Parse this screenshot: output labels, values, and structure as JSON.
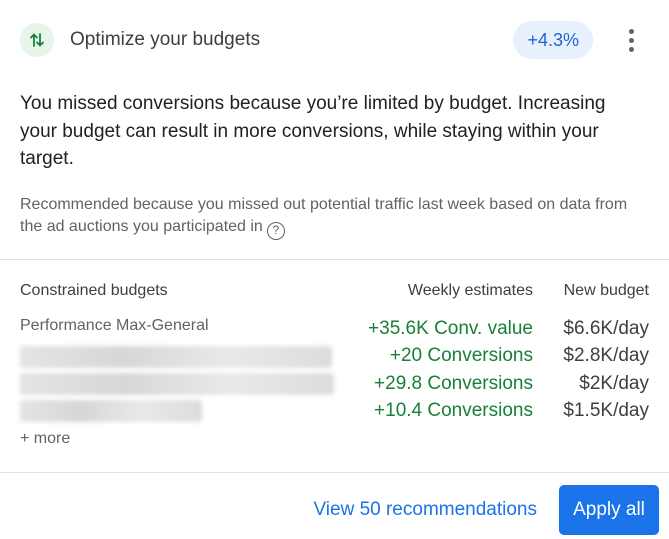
{
  "header": {
    "title": "Optimize your budgets",
    "uplift_badge": "+4.3%",
    "icon": "up-down-arrows-icon",
    "menu_icon": "more-vert-icon"
  },
  "headline": "You missed conversions because you’re limited by budget. Increasing your budget can result in more conversions, while staying within your target.",
  "reason": {
    "text": "Recommended because you missed out potential traffic last week based on data from the ad auctions you participated in",
    "help_icon": "help-circle-icon"
  },
  "table": {
    "headers": {
      "name": "Constrained budgets",
      "weekly": "Weekly estimates",
      "new_budget": "New budget"
    },
    "rows": [
      {
        "name": "Performance Max-General",
        "estimate": "+35.6K Conv. value",
        "new_budget": "$6.6K/day"
      },
      {
        "name": "",
        "estimate": "+20 Conversions",
        "new_budget": "$2.8K/day"
      },
      {
        "name": "",
        "estimate": "+29.8 Conversions",
        "new_budget": "$2K/day"
      },
      {
        "name": "",
        "estimate": "+10.4 Conversions",
        "new_budget": "$1.5K/day"
      }
    ],
    "more_label": "+ more"
  },
  "footer": {
    "view_label": "View 50 recommendations",
    "apply_label": "Apply all"
  },
  "colors": {
    "accent_blue": "#1a73e8",
    "positive_green": "#188038",
    "badge_bg": "#e8f0fe",
    "icon_bg": "#e6f4ea"
  }
}
